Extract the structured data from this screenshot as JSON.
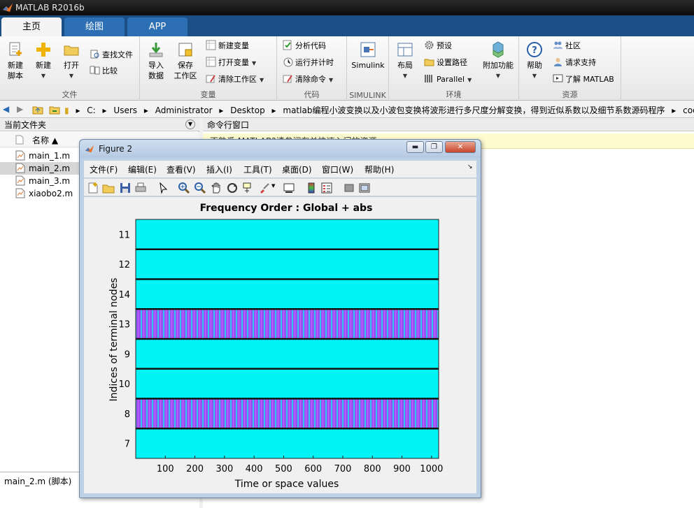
{
  "app": {
    "title": "MATLAB R2016b"
  },
  "tabs": [
    "主页",
    "绘图",
    "APP"
  ],
  "ribbon": {
    "file": {
      "label": "文件",
      "new_script": "新建\n脚本",
      "new": "新建",
      "open": "打开",
      "find_files": "查找文件",
      "compare": "比较"
    },
    "variable": {
      "label": "变量",
      "import": "导入\n数据",
      "save_ws": "保存\n工作区",
      "new_var": "新建变量",
      "open_var": "打开变量",
      "clear_ws": "清除工作区"
    },
    "code": {
      "label": "代码",
      "analyze": "分析代码",
      "run_time": "运行并计时",
      "clear_cmd": "清除命令"
    },
    "simulink": {
      "label": "SIMULINK",
      "simulink": "Simulink"
    },
    "env": {
      "label": "环境",
      "layout": "布局",
      "prefs": "预设",
      "set_path": "设置路径",
      "parallel": "Parallel",
      "addons": "附加功能"
    },
    "resources": {
      "label": "资源",
      "help": "帮助",
      "community": "社区",
      "support": "请求支持",
      "learn": "了解 MATLAB"
    }
  },
  "address": {
    "path": [
      "C:",
      "Users",
      "Administrator",
      "Desktop",
      "matlab编程小波变换以及小波包变换将波形进行多尺度分解变换，得到近似系数以及细节系数源码程序",
      "code"
    ]
  },
  "current_folder": {
    "title": "当前文件夹",
    "column": "名称 ▲",
    "files": [
      "main_1.m",
      "main_2.m",
      "main_3.m",
      "xiaobo2.m"
    ],
    "selected": 1,
    "status": "main_2.m  (脚本)"
  },
  "command_window": {
    "title": "命令行窗口",
    "notice": "不熟悉 MATLAB?请参阅有关快速入门的资源。"
  },
  "figure": {
    "title": "Figure 2",
    "menu": [
      "文件(F)",
      "编辑(E)",
      "查看(V)",
      "插入(I)",
      "工具(T)",
      "桌面(D)",
      "窗口(W)",
      "帮助(H)"
    ],
    "toolbar_icons": [
      "new-figure-icon",
      "open-icon",
      "save-icon",
      "print-icon",
      "pointer-icon",
      "zoom-in-icon",
      "zoom-out-icon",
      "pan-icon",
      "rotate-icon",
      "data-cursor-icon",
      "brush-icon",
      "link-icon",
      "colorbar-icon",
      "legend-icon",
      "hide-tools-icon",
      "show-tools-icon"
    ]
  },
  "chart_data": {
    "type": "heatmap",
    "title": "Frequency Order : Global + abs",
    "xlabel": "Time or space values",
    "ylabel": "Indices of terminal nodes",
    "xticks": [
      100,
      200,
      300,
      400,
      500,
      600,
      700,
      800,
      900,
      1000
    ],
    "xlim": [
      0,
      1024
    ],
    "rows": [
      "11",
      "12",
      "14",
      "13",
      "9",
      "10",
      "8",
      "7"
    ],
    "row_intensity": [
      "low",
      "low",
      "low",
      "high",
      "low",
      "low",
      "high",
      "low"
    ],
    "colors": {
      "low": "#00f3f5",
      "high": "#9a4ff4"
    }
  }
}
